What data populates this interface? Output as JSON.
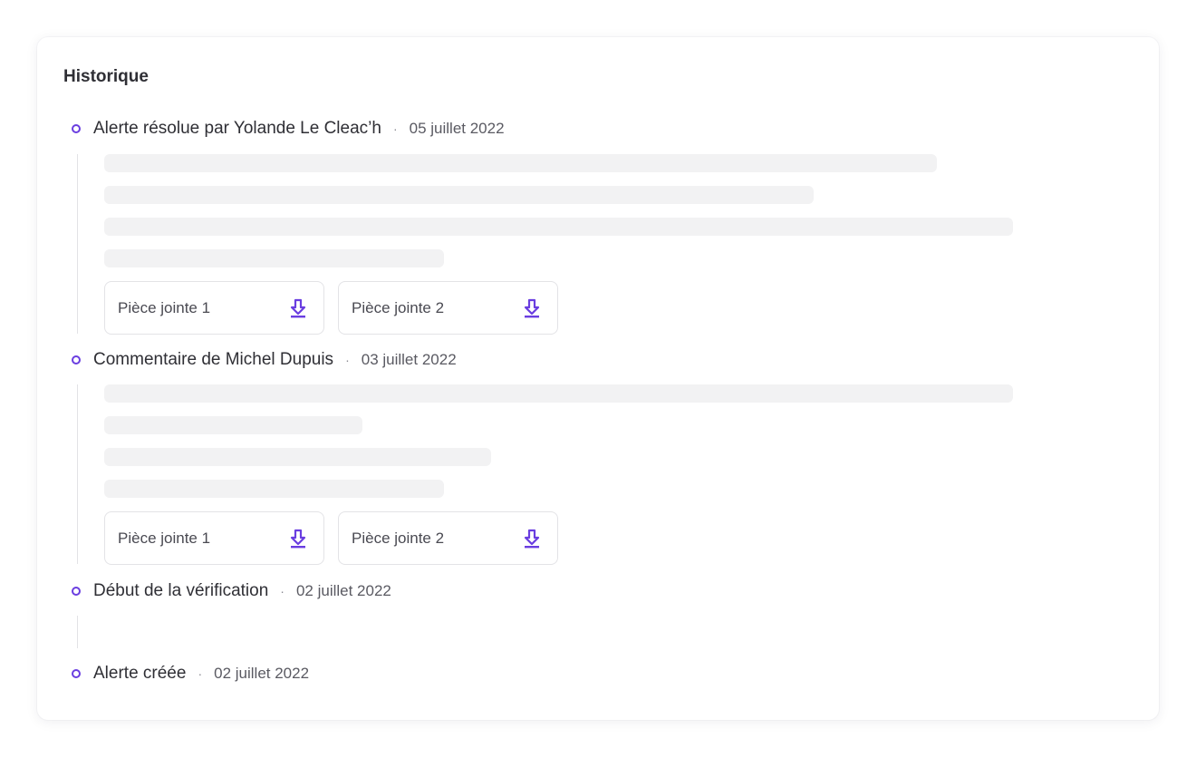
{
  "history": {
    "title": "Historique",
    "entries": [
      {
        "title": "Alerte résolue par Yolande Le Cleac’h",
        "separator": "·",
        "date": "05 juillet 2022",
        "attachments": [
          {
            "label": "Pièce jointe 1",
            "icon": "download-icon"
          },
          {
            "label": "Pièce jointe 2",
            "icon": "download-icon"
          }
        ]
      },
      {
        "title": "Commentaire de Michel Dupuis",
        "separator": "·",
        "date": "03 juillet 2022",
        "attachments": [
          {
            "label": "Pièce jointe 1",
            "icon": "download-icon"
          },
          {
            "label": "Pièce jointe 2",
            "icon": "download-icon"
          }
        ]
      },
      {
        "title": "Début de la vérification",
        "separator": "·",
        "date": "02 juillet 2022"
      },
      {
        "title": "Alerte créée",
        "separator": "·",
        "date": "02 juillet 2022"
      }
    ]
  },
  "colors": {
    "accent": "#6a3ee0",
    "skeleton": "#f2f2f3",
    "timeline_line": "#e2e2e6"
  }
}
